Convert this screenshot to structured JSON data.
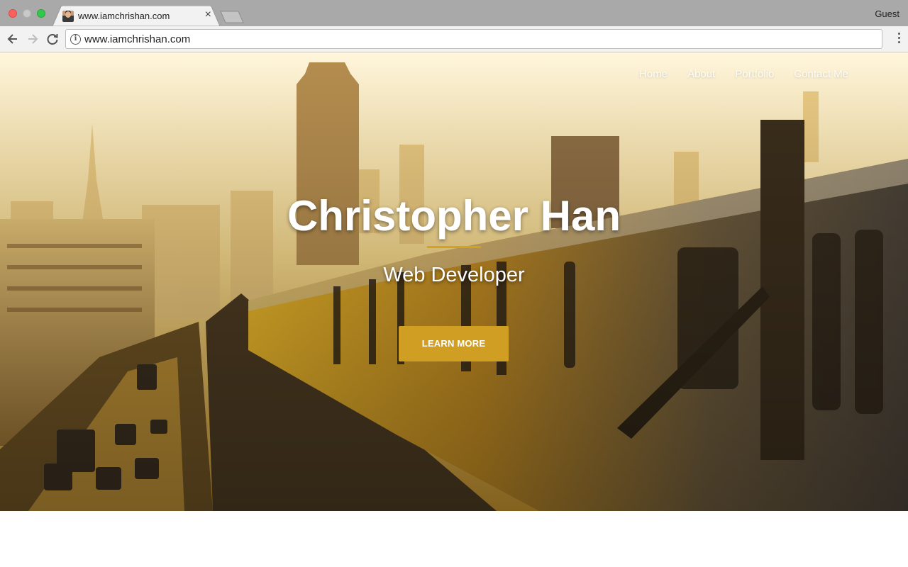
{
  "browser": {
    "tab_title": "www.iamchrishan.com",
    "tab_close": "×",
    "profile": "Guest",
    "url": "www.iamchrishan.com",
    "info_glyph": "i"
  },
  "site": {
    "nav": [
      {
        "label": "Home"
      },
      {
        "label": "About"
      },
      {
        "label": "Portfolio"
      },
      {
        "label": "Contact Me"
      }
    ],
    "hero": {
      "title": "Christopher Han",
      "subtitle": "Web Developer",
      "cta_label": "LEARN MORE"
    }
  },
  "colors": {
    "accent": "#d09e23",
    "tabstrip": "#a9a9a9",
    "toolbar": "#f2f2f2"
  },
  "icons": [
    "back-arrow-icon",
    "forward-arrow-icon",
    "reload-icon",
    "info-icon",
    "menu-dots-icon",
    "close-icon",
    "favicon"
  ]
}
